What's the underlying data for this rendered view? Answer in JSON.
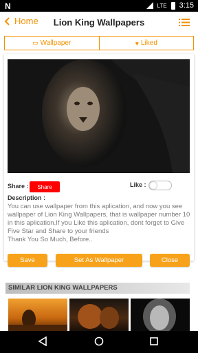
{
  "status_bar": {
    "left_glyph": "N",
    "lte": "LTE",
    "battery": "",
    "time": "3:15"
  },
  "appbar": {
    "back_label": "Home",
    "title": "Lion King Wallpapers"
  },
  "tabs": [
    {
      "label": "Wallpaper",
      "icon": "grid-icon"
    },
    {
      "label": "Liked",
      "icon": "heart-icon"
    }
  ],
  "detail": {
    "share_label": "Share :",
    "share_button": "Share",
    "like_label": "Like :",
    "like_toggle_on": false,
    "description_title": "Description :",
    "description": "You can use wallpaper from this aplication, and now you see wallpaper of Lion King Wallpapers, that is wallpaper number 10 in this aplication.If you Like this aplication, dont forget to Give Five Star and Share to your friends\nThank You So Much, Before..",
    "buttons": {
      "save": "Save",
      "set": "Set As Wallpaper",
      "close": "Close"
    }
  },
  "similar": {
    "title": "SIMILAR LION KING WALLPAPERS"
  },
  "colors": {
    "accent": "#f29200",
    "button": "#f7a21a",
    "share": "#ff0000"
  }
}
